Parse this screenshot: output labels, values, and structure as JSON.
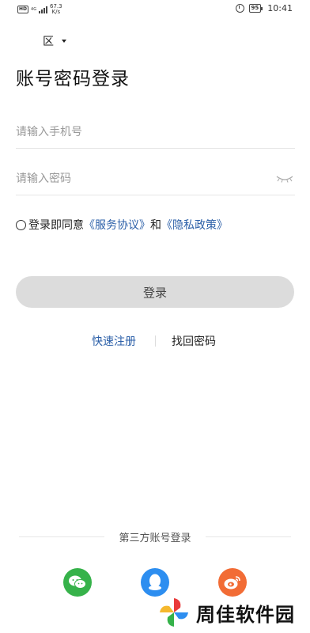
{
  "status_bar": {
    "hd_label": "HD",
    "network_type": "4G",
    "net_speed": "67.3",
    "net_speed_unit": "K/s",
    "battery": "95",
    "time": "10:41",
    "icons": [
      "hd-icon",
      "signal-icon",
      "alarm-icon",
      "battery-icon"
    ]
  },
  "region": {
    "label": "区"
  },
  "title": "账号密码登录",
  "phone_field": {
    "value": "",
    "placeholder": "请输入手机号"
  },
  "password_field": {
    "value": "",
    "placeholder": "请输入密码",
    "toggle_icon": "eye-closed-icon"
  },
  "agreement": {
    "prefix": "登录即同意",
    "service_link": "《服务协议》",
    "conjunction": "和",
    "privacy_link": "《隐私政策》",
    "checked": false
  },
  "login_button": {
    "label": "登录"
  },
  "links": {
    "register": "快速注册",
    "find_password": "找回密码"
  },
  "third_party": {
    "title": "第三方账号登录",
    "providers": [
      "wechat-icon",
      "qq-icon",
      "weibo-icon"
    ]
  },
  "watermark": {
    "text": "周佳软件园"
  },
  "colors": {
    "link_blue": "#2b5fa8",
    "button_gray": "#dcdcdc",
    "wechat_green": "#36b24a",
    "qq_blue": "#2d8ef0",
    "weibo_orange": "#f26c35"
  }
}
